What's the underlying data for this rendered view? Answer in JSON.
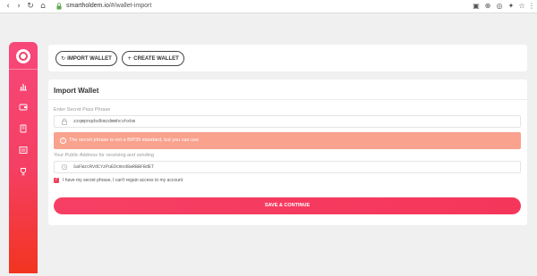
{
  "browser": {
    "url_host": "smartholdem.io",
    "url_path": "/#/wallet-import",
    "nav_icons": [
      "back-icon",
      "forward-icon",
      "reload-icon",
      "home-icon"
    ],
    "ext_icons": [
      "bookmark-icon",
      "download-icon",
      "extension-icon",
      "puzzle-icon",
      "star-icon",
      "menu-icon"
    ]
  },
  "sidebar": {
    "items": [
      {
        "icon": "chart-icon"
      },
      {
        "icon": "wallet-icon"
      },
      {
        "icon": "book-icon"
      },
      {
        "icon": "list-icon"
      },
      {
        "icon": "trophy-icon"
      }
    ],
    "gradient": [
      "#f7487a",
      "#f2341f"
    ]
  },
  "tabs": {
    "import_label": "IMPORT WALLET",
    "create_label": "CREATE WALLET"
  },
  "import": {
    "title": "Import Wallet",
    "passphrase_label": "Enter Secret Pass Phrase",
    "passphrase_value": "zzqmpnqdsdkmzdmmhcvhxkm",
    "warning": "The secret phrase is not a BIP39 standard, but you can use",
    "address_label": "Your Public Address for receiving and sending",
    "address_value": "SaFWzcRVdCYzPuEDcmxd8wRBBFBdET",
    "agree_label": "I have my secret phrase, I can't regain access to my account",
    "save_label": "SAVE & CONTINUE"
  },
  "colors": {
    "accent": "#f53f63",
    "warning_bg": "#f9a28e"
  }
}
